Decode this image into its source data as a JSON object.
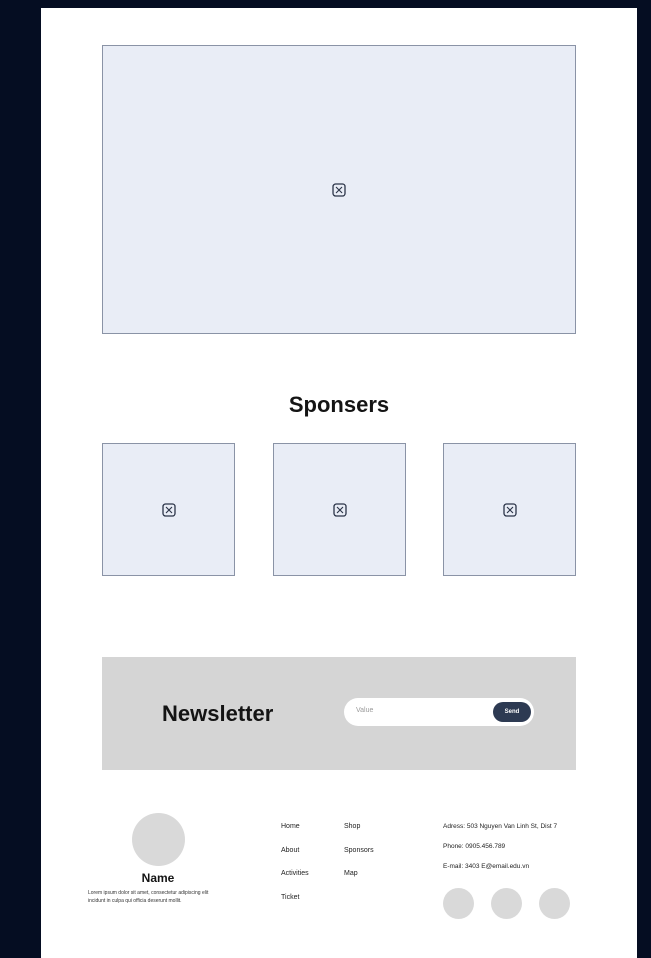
{
  "hero": {
    "icon": "image-placeholder-icon"
  },
  "sponsors": {
    "title": "Sponsers",
    "items": [
      {
        "icon": "image-placeholder-icon"
      },
      {
        "icon": "image-placeholder-icon"
      },
      {
        "icon": "image-placeholder-icon"
      }
    ]
  },
  "newsletter": {
    "title": "Newsletter",
    "input_placeholder": "Value",
    "send_label": "Send"
  },
  "footer": {
    "profile": {
      "name": "Name",
      "description": "Lorem ipsum dolor sit amet, consectetur adipiscing elit incidunt in culpa qui officia deserunt mollit."
    },
    "nav": {
      "col1": [
        "Home",
        "About",
        "Activities",
        "Ticket"
      ],
      "col2": [
        "Shop",
        "Sponsors",
        "Map"
      ]
    },
    "contact": {
      "address": "Adress: 503 Nguyen Van Linh St, Dist 7",
      "phone": "Phone: 0905.456.789",
      "email": "E-mail: 3403 E@email.edu.vn"
    },
    "social": [
      "social-icon",
      "social-icon",
      "social-icon"
    ]
  },
  "colors": {
    "frame_bg": "#050d22",
    "page_bg": "#ffffff",
    "placeholder_bg": "#e9edf6",
    "placeholder_border": "#8a93a6",
    "newsletter_bg": "#d5d5d5",
    "send_button": "#2d3a52",
    "circle_gray": "#d9d9d9"
  }
}
